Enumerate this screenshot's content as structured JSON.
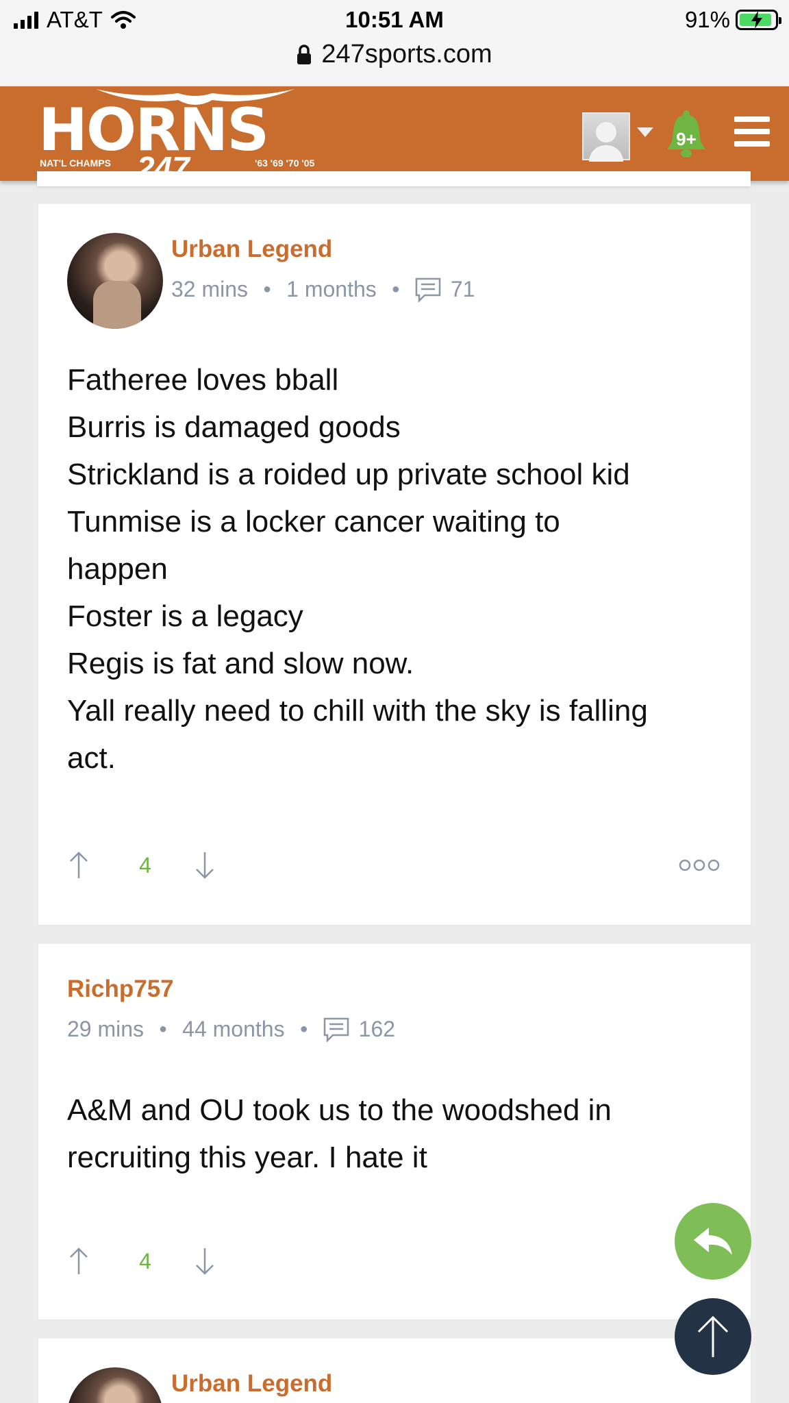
{
  "status_bar": {
    "carrier": "AT&T",
    "time": "10:51 AM",
    "battery": "91%",
    "battery_level": 0.91,
    "url": "247sports.com"
  },
  "site": {
    "logo_text": "HORNS",
    "logo_sub": "NAT'L CHAMPS",
    "logo_num": "247",
    "logo_years": "'63 '69 '70 '05",
    "notification_count": "9+"
  },
  "posts": [
    {
      "author": "Urban Legend",
      "posted": "32 mins",
      "member_since": "1 months",
      "post_count": "71",
      "body": [
        "Fatheree loves bball",
        "Burris is damaged goods",
        "Strickland is a roided up private school kid",
        "Tunmise is a locker cancer waiting to",
        "happen",
        "Foster is a legacy",
        "Regis is fat and slow now.",
        "Yall really need to chill with the sky is falling",
        "act."
      ],
      "votes": "4"
    },
    {
      "author": "Richp757",
      "posted": "29 mins",
      "member_since": "44 months",
      "post_count": "162",
      "body": [
        "A&M and OU took us to the woodshed in",
        "recruiting this year. I hate it"
      ],
      "votes": "4"
    },
    {
      "author": "Urban Legend"
    }
  ],
  "colors": {
    "brand": "#c96d2f",
    "vote": "#6eb544",
    "meta": "#8a96a6",
    "fab_reply": "#7fbd57",
    "fab_top": "#233244"
  }
}
